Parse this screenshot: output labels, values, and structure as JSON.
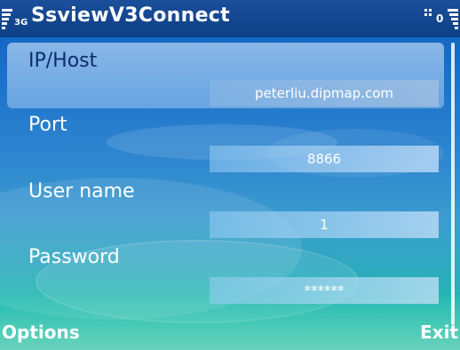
{
  "status_bar": {
    "network_label": "3G",
    "app_title": "SsviewV3Connect",
    "battery_number": "0"
  },
  "form": {
    "fields": [
      {
        "label": "IP/Host",
        "value": "peterliu.dipmap.com"
      },
      {
        "label": "Port",
        "value": "8866"
      },
      {
        "label": "User name",
        "value": "1"
      },
      {
        "label": "Password",
        "value": "******"
      }
    ],
    "selected_index": 0
  },
  "softkeys": {
    "left": "Options",
    "right": "Exit"
  },
  "colors": {
    "status_bar": "#0e3f86",
    "background_top": "#0f5fc0",
    "background_bottom": "#17a89c",
    "selected_text": "#0b2e6a"
  },
  "icons": {
    "signal": "signal-strength-icon",
    "battery": "battery-level-icon",
    "app_menu": "grid-icon"
  }
}
